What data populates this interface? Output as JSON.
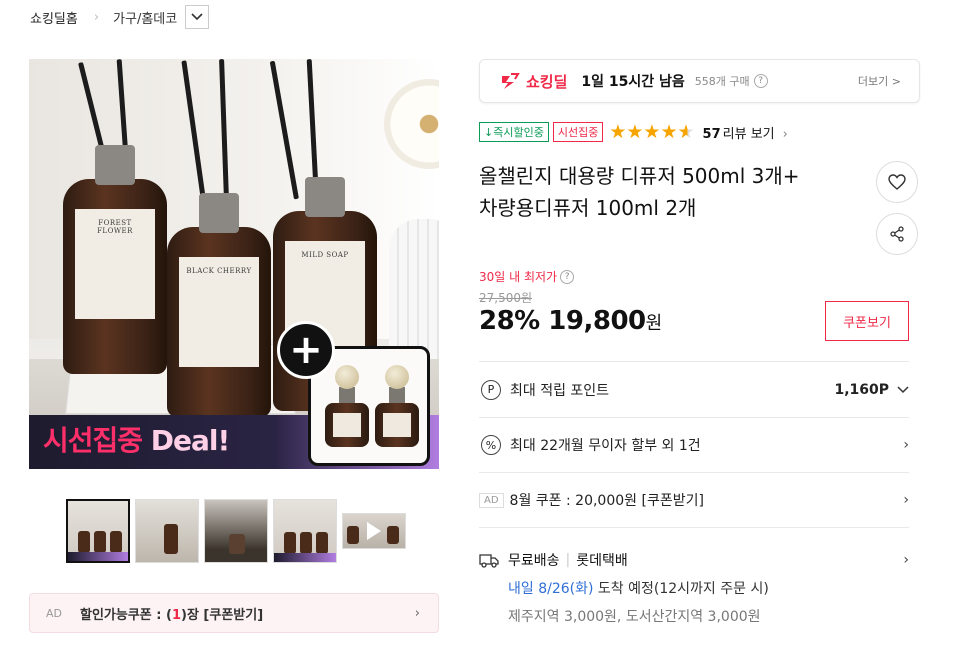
{
  "breadcrumb": {
    "home": "쇼킹딜홈",
    "category": "가구/홈데코"
  },
  "hero": {
    "bottle_labels": [
      "FOREST FLOWER",
      "BLACK CHERRY",
      "MILD SOAP"
    ],
    "banner_ko": "시선집중",
    "banner_en": "Deal!",
    "plus_symbol": "+"
  },
  "thumbnails": [
    "thumb-1",
    "thumb-2",
    "thumb-3",
    "thumb-4",
    "thumb-5-video"
  ],
  "coupon_bar": {
    "ad": "AD",
    "prefix": "할인가능쿠폰 : (",
    "count": "1",
    "suffix": ")장 [쿠폰받기]"
  },
  "deal_box": {
    "logo": "쇼킹딜",
    "time_left": "1일 15시간 남음",
    "purchases": "558개 구매",
    "help": "?",
    "more": "더보기 >"
  },
  "badges": {
    "instant": "↓즉시할인중",
    "focus": "시선집중"
  },
  "rating": {
    "value": 4.5,
    "count": "57",
    "label": "리뷰 보기"
  },
  "product": {
    "title_line1": "올챌린지 대용량 디퓨저 500ml 3개+",
    "title_line2": "차량용디퓨저 100ml 2개"
  },
  "pricing": {
    "low_label": "30일 내 최저가",
    "original": "27,500원",
    "discount": "28%",
    "price": "19,800",
    "won": "원",
    "coupon_button": "쿠폰보기"
  },
  "rows": {
    "points_label": "최대 적립 포인트",
    "points_value": "1,160P",
    "installment": "최대 22개월 무이자 할부 외 1건",
    "coupon_ad": "AD",
    "coupon": "8월 쿠폰 : 20,000원 [쿠폰받기]"
  },
  "shipping": {
    "free": "무료배송",
    "carrier": "롯데택배",
    "arrival": "내일 8/26(화)",
    "arrival_suffix": " 도착 예정(12시까지 주문 시)",
    "extra": "제주지역 3,000원, 도서산간지역 3,000원"
  },
  "colors": {
    "accent": "#ef2947",
    "blue": "#2f6fd6",
    "green": "#0a9b57",
    "star": "#f6a400"
  },
  "icons": [
    "chevron-right-icon",
    "chevron-down-icon",
    "heart-icon",
    "share-icon",
    "point-icon",
    "percent-icon",
    "truck-icon",
    "play-icon",
    "star-icon"
  ]
}
